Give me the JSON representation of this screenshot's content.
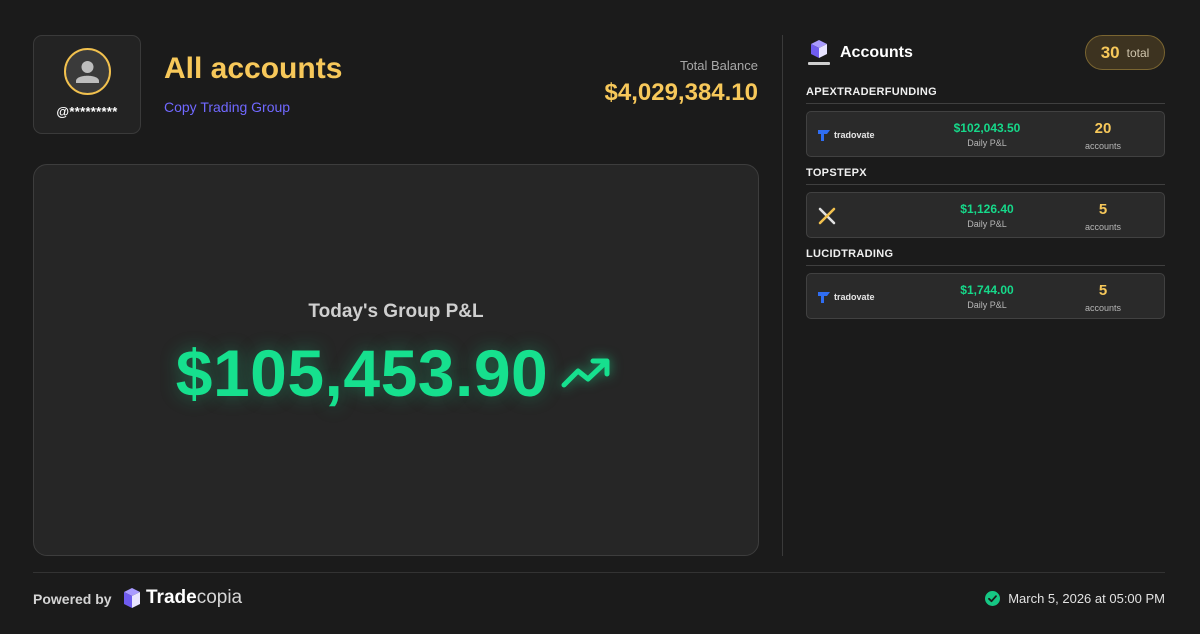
{
  "profile": {
    "masked_handle": "@*********"
  },
  "header": {
    "title": "All accounts",
    "subtitle": "Copy Trading Group",
    "balance_label": "Total Balance",
    "balance_value": "$4,029,384.10"
  },
  "pnl": {
    "label": "Today's Group P&L",
    "value": "$105,453.90",
    "trend_icon": "trend-up-icon"
  },
  "accounts_panel": {
    "title": "Accounts",
    "total_count": "30",
    "total_word": "total",
    "groups": [
      {
        "name": "APEXTRADERFUNDING",
        "broker": "tradovate",
        "pnl": "$102,043.50",
        "pnl_label": "Daily P&L",
        "count": "20",
        "count_label": "accounts"
      },
      {
        "name": "TOPSTEPX",
        "broker": "topstepx",
        "pnl": "$1,126.40",
        "pnl_label": "Daily P&L",
        "count": "5",
        "count_label": "accounts"
      },
      {
        "name": "LUCIDTRADING",
        "broker": "tradovate",
        "pnl": "$1,744.00",
        "pnl_label": "Daily P&L",
        "count": "5",
        "count_label": "accounts"
      }
    ]
  },
  "footer": {
    "powered_by": "Powered by",
    "brand_part1": "Trade",
    "brand_part2": "copia",
    "timestamp": "March 5, 2026 at 05:00 PM"
  },
  "colors": {
    "accent_gold": "#f7c85a",
    "positive_green": "#16e08e",
    "subtitle_purple": "#7068ff",
    "background": "#1b1b1b"
  }
}
